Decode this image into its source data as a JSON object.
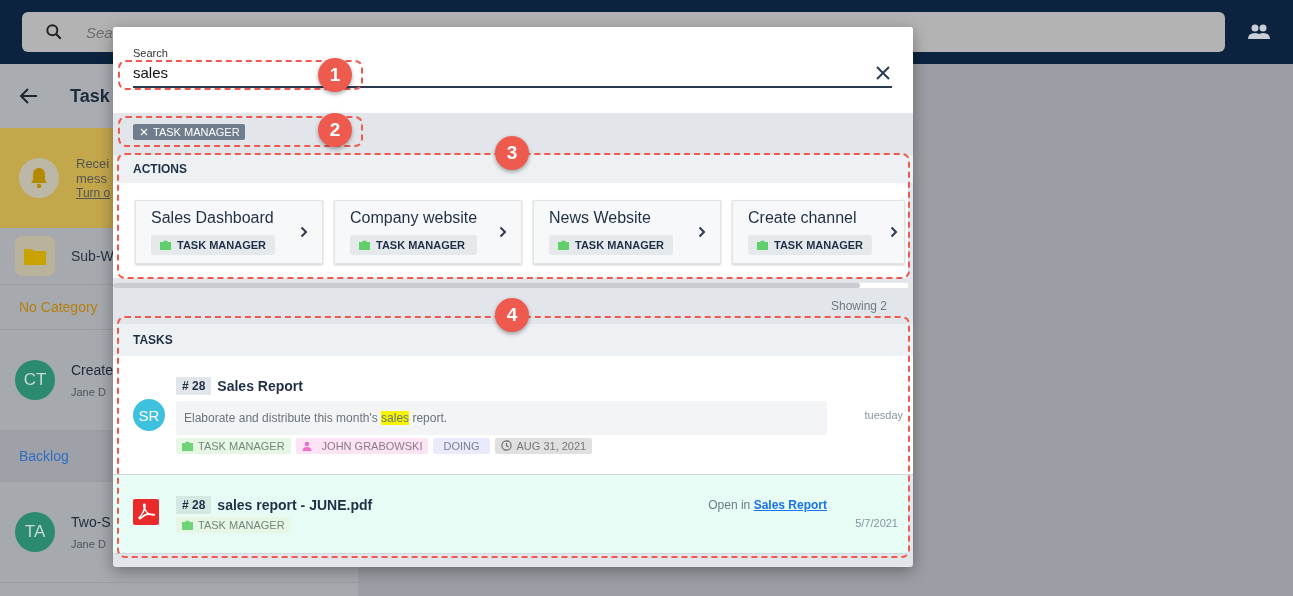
{
  "top_bar": {
    "search_placeholder": "Sea"
  },
  "background_panel": {
    "title": "Task",
    "notification": {
      "lines": [
        "Recei",
        "mess"
      ],
      "link": "Turn o"
    },
    "folder": "Sub-W",
    "groups": [
      {
        "name": "No Category",
        "color": "#b5800f",
        "items": [
          {
            "initials": "CT",
            "title": "Create",
            "subtitle": "Jane D"
          }
        ]
      },
      {
        "name": "Backlog",
        "color": "#2f6fc4",
        "items": [
          {
            "initials": "TA",
            "title": "Two-S",
            "subtitle": "Jane D"
          }
        ]
      }
    ]
  },
  "search_dialog": {
    "search": {
      "label": "Search",
      "value": "sales"
    },
    "filter_chips": [
      {
        "label": "TASK MANAGER"
      }
    ],
    "actions": {
      "heading": "ACTIONS",
      "items": [
        {
          "title": "Sales Dashboard",
          "tag": "TASK MANAGER"
        },
        {
          "title": "Company website",
          "tag": "TASK MANAGER"
        },
        {
          "title": "News Website",
          "tag": "TASK MANAGER"
        },
        {
          "title": "Create channel",
          "tag": "TASK MANAGER"
        }
      ]
    },
    "showing": "Showing 2",
    "tasks": {
      "heading": "TASKS",
      "items": [
        {
          "kind": "task",
          "avatar": "SR",
          "number": "# 28",
          "title": "Sales Report",
          "description_parts": [
            {
              "text": "Elaborate and distribute this month's ",
              "highlighted": false
            },
            {
              "text": "sales",
              "highlighted": true
            },
            {
              "text": " report.",
              "highlighted": false
            }
          ],
          "tags": [
            {
              "kind": "workspace",
              "label": "TASK MANAGER"
            },
            {
              "kind": "assignee",
              "label": "JOHN GRABOWSKI"
            },
            {
              "kind": "status",
              "label": "DOING"
            },
            {
              "kind": "due",
              "label": "AUG 31, 2021"
            }
          ],
          "time": "tuesday"
        },
        {
          "kind": "file",
          "number": "# 28",
          "title": "sales report - JUNE.pdf",
          "tags": [
            {
              "kind": "workspace",
              "label": "TASK MANAGER"
            }
          ],
          "open_in": {
            "prefix": "Open in",
            "link": "Sales Report"
          },
          "time": "5/7/2021"
        }
      ]
    }
  },
  "callouts": [
    "1",
    "2",
    "3",
    "4"
  ]
}
